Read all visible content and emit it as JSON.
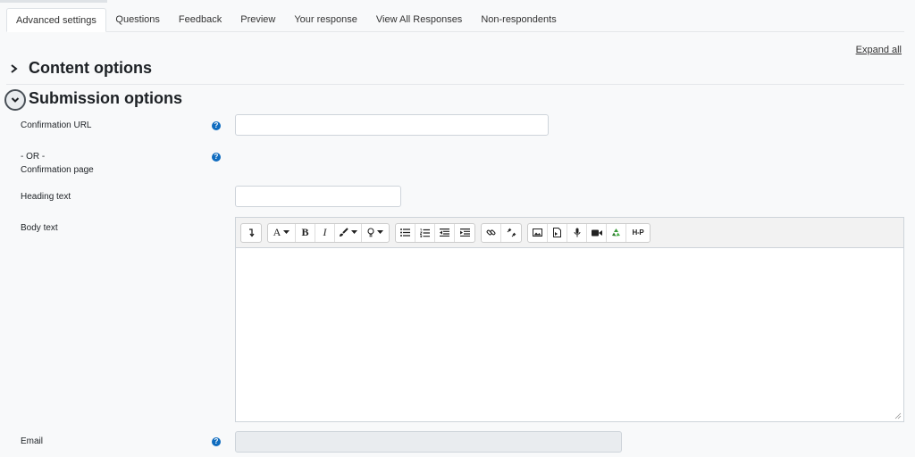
{
  "tabs": [
    {
      "label": "Advanced settings",
      "active": true
    },
    {
      "label": "Questions"
    },
    {
      "label": "Feedback"
    },
    {
      "label": "Preview"
    },
    {
      "label": "Your response"
    },
    {
      "label": "View All Responses"
    },
    {
      "label": "Non-respondents"
    }
  ],
  "expand_all": "Expand all",
  "sections": {
    "content": "Content options",
    "submission": "Submission options"
  },
  "fields": {
    "confirmation_url": {
      "label": "Confirmation URL",
      "value": ""
    },
    "or_label": "- OR -",
    "confirmation_page": "Confirmation page",
    "heading_text": {
      "label": "Heading text",
      "value": ""
    },
    "body_text": {
      "label": "Body text"
    },
    "email": {
      "label": "Email",
      "value": ""
    }
  },
  "help_icon": "?",
  "toolbar": {
    "font_label": "A",
    "bold_label": "B",
    "italic_label": "I",
    "h5p_label": "H-P"
  },
  "colors": {
    "accent": "#0f6cbf",
    "background": "#f8f9fa"
  }
}
